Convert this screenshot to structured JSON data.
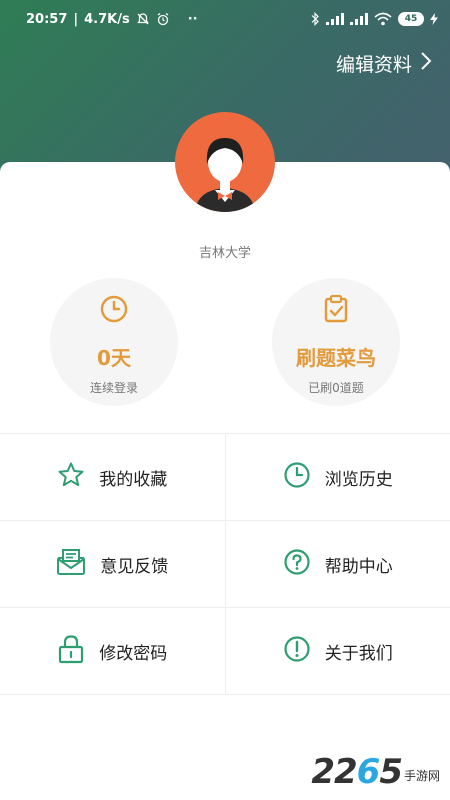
{
  "status_bar": {
    "time": "20:57",
    "speed": "4.7K/s",
    "battery": "45",
    "dots": "··"
  },
  "header": {
    "edit_profile_label": "编辑资料"
  },
  "profile": {
    "school": "吉林大学"
  },
  "stats": [
    {
      "value": "0天",
      "label": "连续登录",
      "icon": "clock-icon"
    },
    {
      "value": "刷题菜鸟",
      "label": "已刷0道题",
      "icon": "clipboard-check-icon"
    }
  ],
  "menu": [
    {
      "label": "我的收藏",
      "icon": "star-icon"
    },
    {
      "label": "浏览历史",
      "icon": "clock-icon"
    },
    {
      "label": "意见反馈",
      "icon": "envelope-icon"
    },
    {
      "label": "帮助中心",
      "icon": "question-icon"
    },
    {
      "label": "修改密码",
      "icon": "lock-icon"
    },
    {
      "label": "关于我们",
      "icon": "exclamation-icon"
    }
  ],
  "watermark": {
    "number_part1": "22",
    "number_part2": "6",
    "number_part3": "5",
    "text": "手游网"
  },
  "colors": {
    "accent_orange": "#e39a3b",
    "menu_green": "#2e9e72",
    "avatar_bg": "#ef6b3f"
  }
}
